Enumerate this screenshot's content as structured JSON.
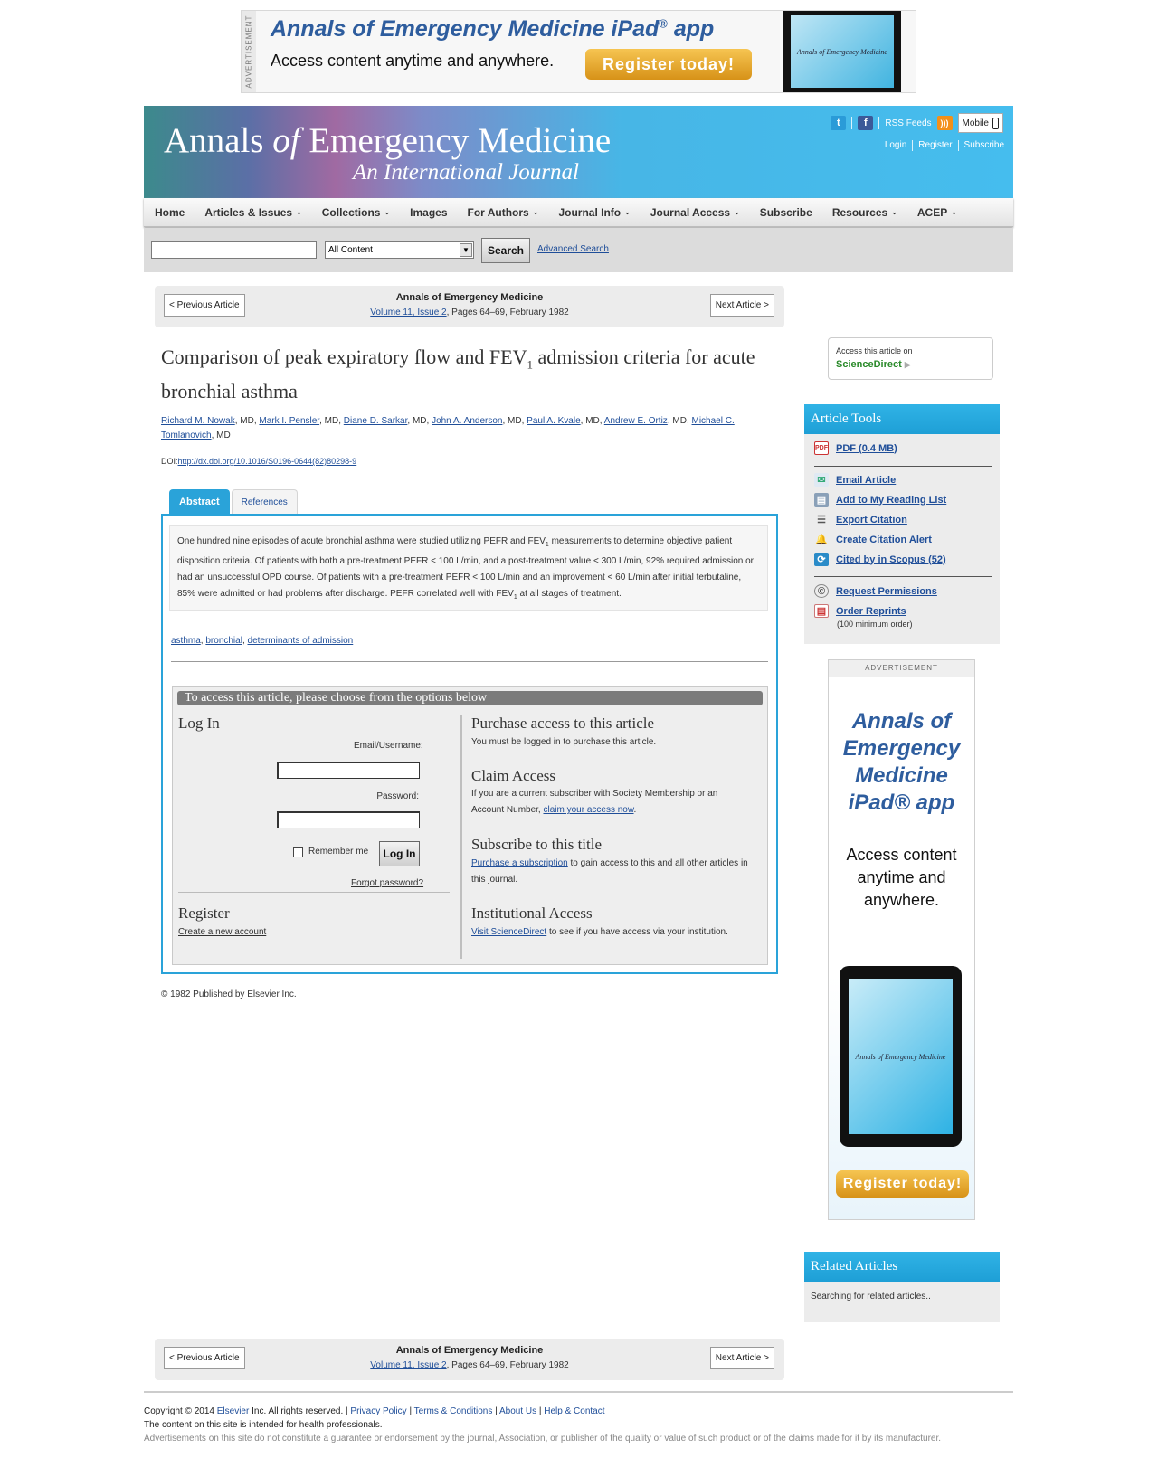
{
  "top_ad": {
    "label": "ADVERTISEMENT",
    "title": "Annals of Emergency Medicine iPad",
    "title_sup": "®",
    "title_suffix": " app",
    "subtitle": "Access content anytime and anywhere.",
    "button": "Register today!",
    "device_text": "Annals of Emergency Medicine"
  },
  "header": {
    "logo_line1_a": "Annals ",
    "logo_line1_of": "of",
    "logo_line1_b": " Emergency Medicine",
    "logo_line2": "An International Journal",
    "rss": "RSS Feeds",
    "mobile": "Mobile",
    "login": "Login",
    "register": "Register",
    "subscribe": "Subscribe"
  },
  "nav": {
    "items": [
      "Home",
      "Articles & Issues",
      "Collections",
      "Images",
      "For Authors",
      "Journal Info",
      "Journal Access",
      "Subscribe",
      "Resources",
      "ACEP"
    ]
  },
  "search": {
    "query": "",
    "scope": "All Content",
    "button": "Search",
    "advanced": "Advanced Search"
  },
  "article_nav": {
    "prev": "< Previous Article",
    "next": "Next Article >",
    "journal": "Annals of Emergency Medicine",
    "volume": "Volume 11, Issue 2",
    "pages": ", Pages 64–69, February 1982"
  },
  "article": {
    "title_a": "Comparison of peak expiratory flow and FEV",
    "title_sub": "1",
    "title_b": " admission criteria for acute bronchial asthma",
    "authors": [
      "Richard M. Nowak",
      "Mark I. Pensler",
      "Diane D. Sarkar",
      "John A. Anderson",
      "Paul A. Kvale",
      "Andrew E. Ortiz",
      "Michael C. Tomlanovich"
    ],
    "degree": "MD",
    "doi_label": "DOI:",
    "doi": "http://dx.doi.org/10.1016/S0196-0644(82)80298-9",
    "tabs": [
      "Abstract",
      "References"
    ],
    "abstract": {
      "p1": "One hundred nine episodes of acute bronchial asthma were studied utilizing PEFR and FEV",
      "s1": "1",
      "p2": " measurements to determine objective patient disposition criteria. Of patients with both a pre-treatment PEFR < 100 L/min, and a post-treatment value < 300 L/min, 92% required admission or had an unsuccessful OPD course. Of patients with a pre-treatment PEFR < 100 L/min and an improvement < 60 L/min after initial terbutaline, 85% were admitted or had problems after discharge. PEFR correlated well with FEV",
      "s2": "1",
      "p3": " at all stages of treatment."
    },
    "keywords": [
      "asthma",
      "bronchial",
      "determinants of admission"
    ],
    "copyright": "© 1982 Published by Elsevier Inc."
  },
  "access": {
    "header": "To access this article, please choose from the options below",
    "login_title": "Log In",
    "email_label": "Email/Username:",
    "email_value": "",
    "password_label": "Password:",
    "password_value": "",
    "remember": "Remember me",
    "login_button": "Log In",
    "forgot": "Forgot password?",
    "register_title": "Register",
    "register_link": "Create a new account",
    "purchase_title": "Purchase access to this article",
    "purchase_text": "You must be logged in to purchase this article.",
    "claim_title": "Claim Access",
    "claim_text": "If you are a current subscriber with Society Membership or an Account Number, ",
    "claim_link": "claim your access now",
    "claim_end": ".",
    "subscribe_title": "Subscribe to this title",
    "subscribe_link": "Purchase a subscription",
    "subscribe_text": " to gain access to this and all other articles in this journal.",
    "inst_title": "Institutional Access",
    "inst_link": "Visit ScienceDirect",
    "inst_text": " to see if you have access via your institution."
  },
  "sidebar": {
    "sd_line1": "Access this article on",
    "sd_line2": "ScienceDirect",
    "tools_title": "Article Tools",
    "tools": [
      "PDF (0.4 MB)",
      "Email Article",
      "Add to My Reading List",
      "Export Citation",
      "Create Citation Alert",
      "Cited by in Scopus (52)",
      "Request Permissions",
      "Order Reprints"
    ],
    "min_order": "(100 minimum order)",
    "ad_label": "ADVERTISEMENT",
    "ad_title_1": "Annals of",
    "ad_title_2": "Emergency",
    "ad_title_3": "Medicine",
    "ad_title_4": "iPad® app",
    "ad_text_1": "Access content",
    "ad_text_2": "anytime and",
    "ad_text_3": "anywhere.",
    "ad_device": "Annals of Emergency Medicine",
    "ad_button": "Register today!",
    "related_title": "Related Articles",
    "related_text": "Searching for related articles.."
  },
  "footer": {
    "copyright_a": "Copyright © 2014 ",
    "elsevier": "Elsevier",
    "copyright_b": " Inc. All rights reserved. | ",
    "privacy": "Privacy Policy",
    "terms": "Terms & Conditions",
    "about": "About Us",
    "help": "Help & Contact",
    "line2": "The content on this site is intended for health professionals.",
    "line3": "Advertisements on this site do not constitute a guarantee or endorsement by the journal, Association, or publisher of the quality or value of such product or of the claims made for it by its manufacturer."
  },
  "colors": {
    "accent_blue": "#2aa3d9",
    "link": "#1f4e99",
    "ad_orange": "#e0a22a",
    "sciencedirect_green": "#2a8a2a"
  }
}
